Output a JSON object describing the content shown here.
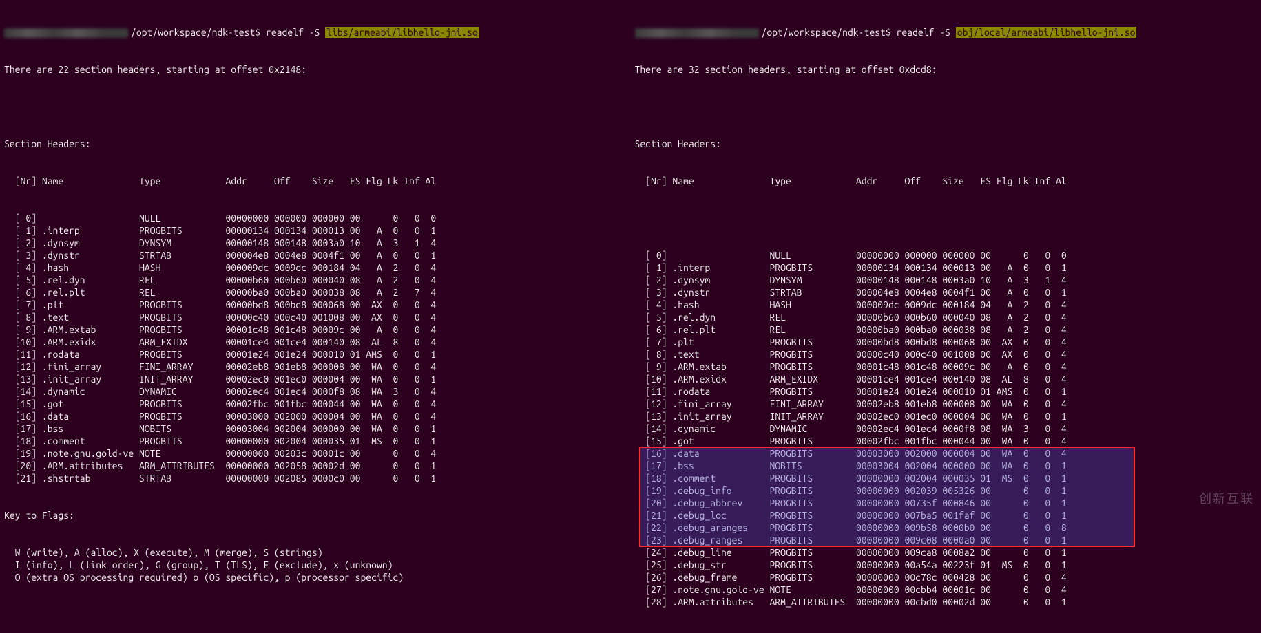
{
  "left": {
    "prompt": "/opt/workspace/ndk-test$ readelf -S ",
    "hl_path": "libs/armeabi/libhello-jni.so",
    "summary": "There are 22 section headers, starting at offset 0x2148:",
    "section_title": "Section Headers:",
    "columns_line": "  [Nr] Name              Type            Addr     Off    Size   ES Flg Lk Inf Al",
    "rows": [
      {
        "nr": "[ 0]",
        "name": "",
        "type": "NULL",
        "addr": "00000000",
        "off": "000000",
        "size": "000000",
        "es": "00",
        "flg": "",
        "lk": "0",
        "inf": "0",
        "al": "0"
      },
      {
        "nr": "[ 1]",
        "name": ".interp",
        "type": "PROGBITS",
        "addr": "00000134",
        "off": "000134",
        "size": "000013",
        "es": "00",
        "flg": "A",
        "lk": "0",
        "inf": "0",
        "al": "1"
      },
      {
        "nr": "[ 2]",
        "name": ".dynsym",
        "type": "DYNSYM",
        "addr": "00000148",
        "off": "000148",
        "size": "0003a0",
        "es": "10",
        "flg": "A",
        "lk": "3",
        "inf": "1",
        "al": "4"
      },
      {
        "nr": "[ 3]",
        "name": ".dynstr",
        "type": "STRTAB",
        "addr": "000004e8",
        "off": "0004e8",
        "size": "0004f1",
        "es": "00",
        "flg": "A",
        "lk": "0",
        "inf": "0",
        "al": "1"
      },
      {
        "nr": "[ 4]",
        "name": ".hash",
        "type": "HASH",
        "addr": "000009dc",
        "off": "0009dc",
        "size": "000184",
        "es": "04",
        "flg": "A",
        "lk": "2",
        "inf": "0",
        "al": "4"
      },
      {
        "nr": "[ 5]",
        "name": ".rel.dyn",
        "type": "REL",
        "addr": "00000b60",
        "off": "000b60",
        "size": "000040",
        "es": "08",
        "flg": "A",
        "lk": "2",
        "inf": "0",
        "al": "4"
      },
      {
        "nr": "[ 6]",
        "name": ".rel.plt",
        "type": "REL",
        "addr": "00000ba0",
        "off": "000ba0",
        "size": "000038",
        "es": "08",
        "flg": "A",
        "lk": "2",
        "inf": "7",
        "al": "4"
      },
      {
        "nr": "[ 7]",
        "name": ".plt",
        "type": "PROGBITS",
        "addr": "00000bd8",
        "off": "000bd8",
        "size": "000068",
        "es": "00",
        "flg": "AX",
        "lk": "0",
        "inf": "0",
        "al": "4"
      },
      {
        "nr": "[ 8]",
        "name": ".text",
        "type": "PROGBITS",
        "addr": "00000c40",
        "off": "000c40",
        "size": "001008",
        "es": "00",
        "flg": "AX",
        "lk": "0",
        "inf": "0",
        "al": "4"
      },
      {
        "nr": "[ 9]",
        "name": ".ARM.extab",
        "type": "PROGBITS",
        "addr": "00001c48",
        "off": "001c48",
        "size": "00009c",
        "es": "00",
        "flg": "A",
        "lk": "0",
        "inf": "0",
        "al": "4"
      },
      {
        "nr": "[10]",
        "name": ".ARM.exidx",
        "type": "ARM_EXIDX",
        "addr": "00001ce4",
        "off": "001ce4",
        "size": "000140",
        "es": "08",
        "flg": "AL",
        "lk": "8",
        "inf": "0",
        "al": "4"
      },
      {
        "nr": "[11]",
        "name": ".rodata",
        "type": "PROGBITS",
        "addr": "00001e24",
        "off": "001e24",
        "size": "000010",
        "es": "01",
        "flg": "AMS",
        "lk": "0",
        "inf": "0",
        "al": "1"
      },
      {
        "nr": "[12]",
        "name": ".fini_array",
        "type": "FINI_ARRAY",
        "addr": "00002eb8",
        "off": "001eb8",
        "size": "000008",
        "es": "00",
        "flg": "WA",
        "lk": "0",
        "inf": "0",
        "al": "4"
      },
      {
        "nr": "[13]",
        "name": ".init_array",
        "type": "INIT_ARRAY",
        "addr": "00002ec0",
        "off": "001ec0",
        "size": "000004",
        "es": "00",
        "flg": "WA",
        "lk": "0",
        "inf": "0",
        "al": "1"
      },
      {
        "nr": "[14]",
        "name": ".dynamic",
        "type": "DYNAMIC",
        "addr": "00002ec4",
        "off": "001ec4",
        "size": "0000f8",
        "es": "08",
        "flg": "WA",
        "lk": "3",
        "inf": "0",
        "al": "4"
      },
      {
        "nr": "[15]",
        "name": ".got",
        "type": "PROGBITS",
        "addr": "00002fbc",
        "off": "001fbc",
        "size": "000044",
        "es": "00",
        "flg": "WA",
        "lk": "0",
        "inf": "0",
        "al": "4"
      },
      {
        "nr": "[16]",
        "name": ".data",
        "type": "PROGBITS",
        "addr": "00003000",
        "off": "002000",
        "size": "000004",
        "es": "00",
        "flg": "WA",
        "lk": "0",
        "inf": "0",
        "al": "4"
      },
      {
        "nr": "[17]",
        "name": ".bss",
        "type": "NOBITS",
        "addr": "00003004",
        "off": "002004",
        "size": "000000",
        "es": "00",
        "flg": "WA",
        "lk": "0",
        "inf": "0",
        "al": "1"
      },
      {
        "nr": "[18]",
        "name": ".comment",
        "type": "PROGBITS",
        "addr": "00000000",
        "off": "002004",
        "size": "000035",
        "es": "01",
        "flg": "MS",
        "lk": "0",
        "inf": "0",
        "al": "1"
      },
      {
        "nr": "[19]",
        "name": ".note.gnu.gold-ve",
        "type": "NOTE",
        "addr": "00000000",
        "off": "00203c",
        "size": "00001c",
        "es": "00",
        "flg": "",
        "lk": "0",
        "inf": "0",
        "al": "4"
      },
      {
        "nr": "[20]",
        "name": ".ARM.attributes",
        "type": "ARM_ATTRIBUTES",
        "addr": "00000000",
        "off": "002058",
        "size": "00002d",
        "es": "00",
        "flg": "",
        "lk": "0",
        "inf": "0",
        "al": "1"
      },
      {
        "nr": "[21]",
        "name": ".shstrtab",
        "type": "STRTAB",
        "addr": "00000000",
        "off": "002085",
        "size": "0000c0",
        "es": "00",
        "flg": "",
        "lk": "0",
        "inf": "0",
        "al": "1"
      }
    ],
    "key_title": "Key to Flags:",
    "key_lines": [
      "  W (write), A (alloc), X (execute), M (merge), S (strings)",
      "  I (info), L (link order), G (group), T (TLS), E (exclude), x (unknown)",
      "  O (extra OS processing required) o (OS specific), p (processor specific)"
    ]
  },
  "right": {
    "prompt": "/opt/workspace/ndk-test$ readelf -S ",
    "hl_path": "obj/local/armeabi/libhello-jni.so",
    "summary": "There are 32 section headers, starting at offset 0xdcd8:",
    "section_title": "Section Headers:",
    "columns_line": "  [Nr] Name              Type            Addr     Off    Size   ES Flg Lk Inf Al",
    "rows": [
      {
        "nr": "[ 0]",
        "name": "",
        "type": "NULL",
        "addr": "00000000",
        "off": "000000",
        "size": "000000",
        "es": "00",
        "flg": "",
        "lk": "0",
        "inf": "0",
        "al": "0"
      },
      {
        "nr": "[ 1]",
        "name": ".interp",
        "type": "PROGBITS",
        "addr": "00000134",
        "off": "000134",
        "size": "000013",
        "es": "00",
        "flg": "A",
        "lk": "0",
        "inf": "0",
        "al": "1"
      },
      {
        "nr": "[ 2]",
        "name": ".dynsym",
        "type": "DYNSYM",
        "addr": "00000148",
        "off": "000148",
        "size": "0003a0",
        "es": "10",
        "flg": "A",
        "lk": "3",
        "inf": "1",
        "al": "4"
      },
      {
        "nr": "[ 3]",
        "name": ".dynstr",
        "type": "STRTAB",
        "addr": "000004e8",
        "off": "0004e8",
        "size": "0004f1",
        "es": "00",
        "flg": "A",
        "lk": "0",
        "inf": "0",
        "al": "1"
      },
      {
        "nr": "[ 4]",
        "name": ".hash",
        "type": "HASH",
        "addr": "000009dc",
        "off": "0009dc",
        "size": "000184",
        "es": "04",
        "flg": "A",
        "lk": "2",
        "inf": "0",
        "al": "4"
      },
      {
        "nr": "[ 5]",
        "name": ".rel.dyn",
        "type": "REL",
        "addr": "00000b60",
        "off": "000b60",
        "size": "000040",
        "es": "08",
        "flg": "A",
        "lk": "2",
        "inf": "0",
        "al": "4"
      },
      {
        "nr": "[ 6]",
        "name": ".rel.plt",
        "type": "REL",
        "addr": "00000ba0",
        "off": "000ba0",
        "size": "000038",
        "es": "08",
        "flg": "A",
        "lk": "2",
        "inf": "0",
        "al": "4"
      },
      {
        "nr": "[ 7]",
        "name": ".plt",
        "type": "PROGBITS",
        "addr": "00000bd8",
        "off": "000bd8",
        "size": "000068",
        "es": "00",
        "flg": "AX",
        "lk": "0",
        "inf": "0",
        "al": "4"
      },
      {
        "nr": "[ 8]",
        "name": ".text",
        "type": "PROGBITS",
        "addr": "00000c40",
        "off": "000c40",
        "size": "001008",
        "es": "00",
        "flg": "AX",
        "lk": "0",
        "inf": "0",
        "al": "4"
      },
      {
        "nr": "[ 9]",
        "name": ".ARM.extab",
        "type": "PROGBITS",
        "addr": "00001c48",
        "off": "001c48",
        "size": "00009c",
        "es": "00",
        "flg": "A",
        "lk": "0",
        "inf": "0",
        "al": "4"
      },
      {
        "nr": "[10]",
        "name": ".ARM.exidx",
        "type": "ARM_EXIDX",
        "addr": "00001ce4",
        "off": "001ce4",
        "size": "000140",
        "es": "08",
        "flg": "AL",
        "lk": "8",
        "inf": "0",
        "al": "4"
      },
      {
        "nr": "[11]",
        "name": ".rodata",
        "type": "PROGBITS",
        "addr": "00001e24",
        "off": "001e24",
        "size": "000010",
        "es": "01",
        "flg": "AMS",
        "lk": "0",
        "inf": "0",
        "al": "1"
      },
      {
        "nr": "[12]",
        "name": ".fini_array",
        "type": "FINI_ARRAY",
        "addr": "00002eb8",
        "off": "001eb8",
        "size": "000008",
        "es": "00",
        "flg": "WA",
        "lk": "0",
        "inf": "0",
        "al": "4"
      },
      {
        "nr": "[13]",
        "name": ".init_array",
        "type": "INIT_ARRAY",
        "addr": "00002ec0",
        "off": "001ec0",
        "size": "000004",
        "es": "00",
        "flg": "WA",
        "lk": "0",
        "inf": "0",
        "al": "1"
      },
      {
        "nr": "[14]",
        "name": ".dynamic",
        "type": "DYNAMIC",
        "addr": "00002ec4",
        "off": "001ec4",
        "size": "0000f8",
        "es": "08",
        "flg": "WA",
        "lk": "3",
        "inf": "0",
        "al": "4"
      },
      {
        "nr": "[15]",
        "name": ".got",
        "type": "PROGBITS",
        "addr": "00002fbc",
        "off": "001fbc",
        "size": "000044",
        "es": "00",
        "flg": "WA",
        "lk": "0",
        "inf": "0",
        "al": "4"
      },
      {
        "nr": "[16]",
        "name": ".data",
        "type": "PROGBITS",
        "addr": "00003000",
        "off": "002000",
        "size": "000004",
        "es": "00",
        "flg": "WA",
        "lk": "0",
        "inf": "0",
        "al": "4"
      },
      {
        "nr": "[17]",
        "name": ".bss",
        "type": "NOBITS",
        "addr": "00003004",
        "off": "002004",
        "size": "000000",
        "es": "00",
        "flg": "WA",
        "lk": "0",
        "inf": "0",
        "al": "1"
      },
      {
        "nr": "[18]",
        "name": ".comment",
        "type": "PROGBITS",
        "addr": "00000000",
        "off": "002004",
        "size": "000035",
        "es": "01",
        "flg": "MS",
        "lk": "0",
        "inf": "0",
        "al": "1"
      },
      {
        "nr": "[19]",
        "name": ".debug_info",
        "type": "PROGBITS",
        "addr": "00000000",
        "off": "002039",
        "size": "005326",
        "es": "00",
        "flg": "",
        "lk": "0",
        "inf": "0",
        "al": "1"
      },
      {
        "nr": "[20]",
        "name": ".debug_abbrev",
        "type": "PROGBITS",
        "addr": "00000000",
        "off": "00735f",
        "size": "000846",
        "es": "00",
        "flg": "",
        "lk": "0",
        "inf": "0",
        "al": "1"
      },
      {
        "nr": "[21]",
        "name": ".debug_loc",
        "type": "PROGBITS",
        "addr": "00000000",
        "off": "007ba5",
        "size": "001faf",
        "es": "00",
        "flg": "",
        "lk": "0",
        "inf": "0",
        "al": "1"
      },
      {
        "nr": "[22]",
        "name": ".debug_aranges",
        "type": "PROGBITS",
        "addr": "00000000",
        "off": "009b58",
        "size": "0000b0",
        "es": "00",
        "flg": "",
        "lk": "0",
        "inf": "0",
        "al": "8"
      },
      {
        "nr": "[23]",
        "name": ".debug_ranges",
        "type": "PROGBITS",
        "addr": "00000000",
        "off": "009c08",
        "size": "0000a0",
        "es": "00",
        "flg": "",
        "lk": "0",
        "inf": "0",
        "al": "1"
      },
      {
        "nr": "[24]",
        "name": ".debug_line",
        "type": "PROGBITS",
        "addr": "00000000",
        "off": "009ca8",
        "size": "0008a2",
        "es": "00",
        "flg": "",
        "lk": "0",
        "inf": "0",
        "al": "1"
      },
      {
        "nr": "[25]",
        "name": ".debug_str",
        "type": "PROGBITS",
        "addr": "00000000",
        "off": "00a54a",
        "size": "00223f",
        "es": "01",
        "flg": "MS",
        "lk": "0",
        "inf": "0",
        "al": "1"
      },
      {
        "nr": "[26]",
        "name": ".debug_frame",
        "type": "PROGBITS",
        "addr": "00000000",
        "off": "00c78c",
        "size": "000428",
        "es": "00",
        "flg": "",
        "lk": "0",
        "inf": "0",
        "al": "4"
      },
      {
        "nr": "[27]",
        "name": ".note.gnu.gold-ve",
        "type": "NOTE",
        "addr": "00000000",
        "off": "00cbb4",
        "size": "00001c",
        "es": "00",
        "flg": "",
        "lk": "0",
        "inf": "0",
        "al": "4"
      },
      {
        "nr": "[28]",
        "name": ".ARM.attributes",
        "type": "ARM_ATTRIBUTES",
        "addr": "00000000",
        "off": "00cbd0",
        "size": "00002d",
        "es": "00",
        "flg": "",
        "lk": "0",
        "inf": "0",
        "al": "1"
      }
    ]
  },
  "watermark": "创新互联"
}
